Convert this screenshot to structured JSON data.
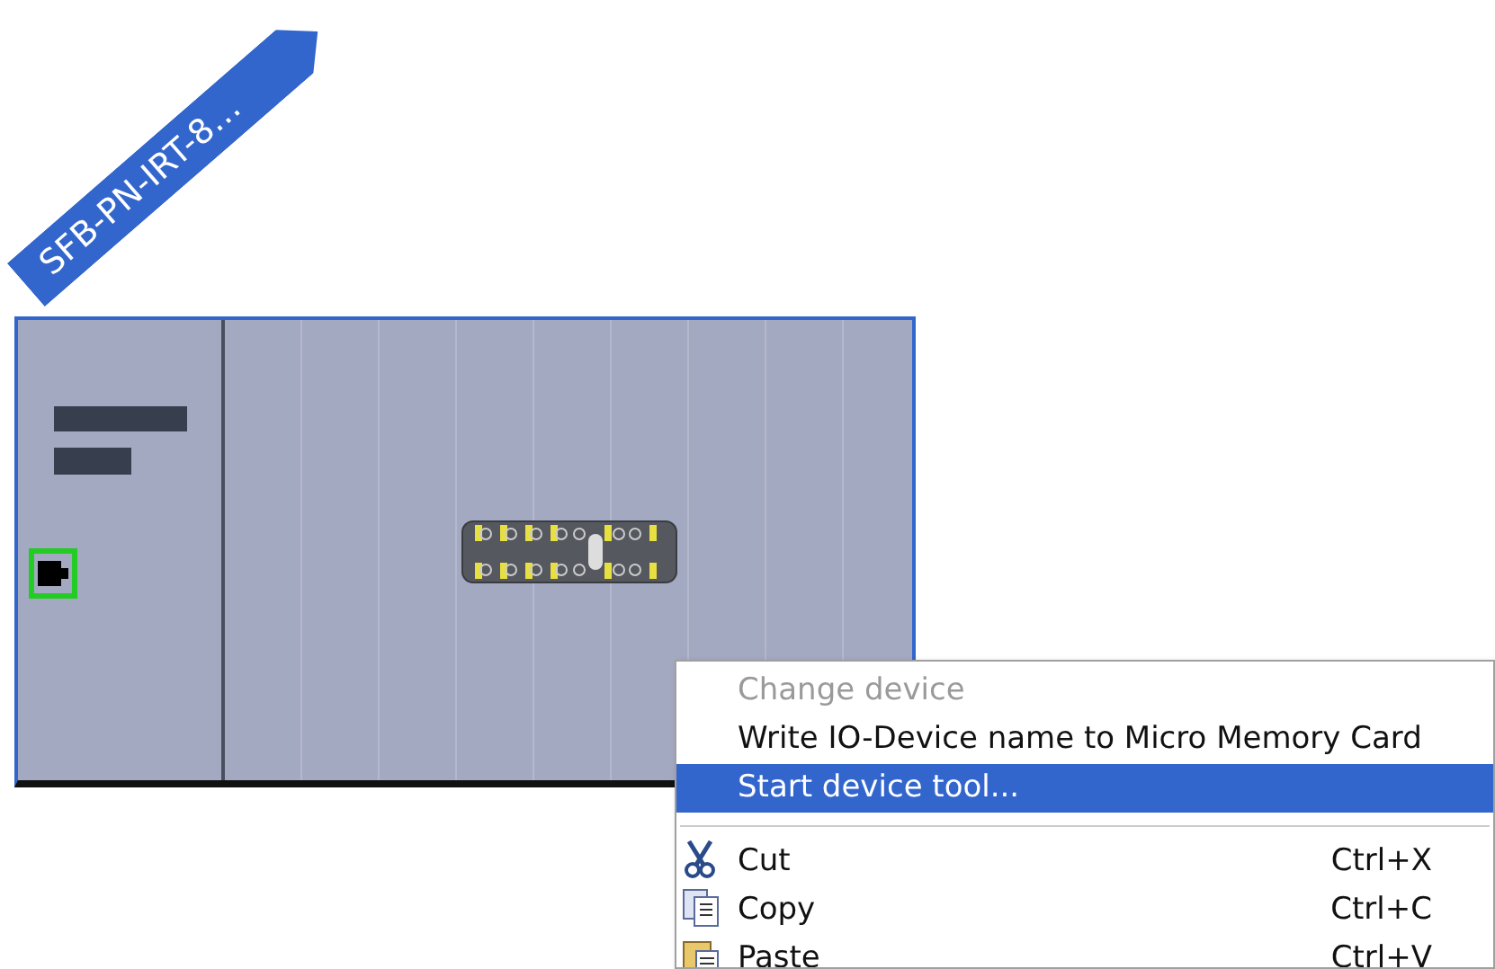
{
  "device": {
    "label": "SFB-PN-IRT-8…",
    "port_selected": true
  },
  "context_menu": {
    "items": [
      {
        "kind": "item",
        "label": "Change device",
        "disabled": true,
        "selected": false
      },
      {
        "kind": "item",
        "label": "Write IO-Device name to Micro Memory Card",
        "disabled": false,
        "selected": false
      },
      {
        "kind": "item",
        "label": "Start device tool...",
        "disabled": false,
        "selected": true
      },
      {
        "kind": "separator"
      },
      {
        "kind": "item",
        "label": "Cut",
        "shortcut": "Ctrl+X",
        "disabled": false,
        "selected": false
      },
      {
        "kind": "item",
        "label": "Copy",
        "shortcut": "Ctrl+C",
        "disabled": false,
        "selected": false
      },
      {
        "kind": "item",
        "label": "Paste",
        "shortcut": "Ctrl+V",
        "disabled": false,
        "selected": false
      }
    ]
  }
}
